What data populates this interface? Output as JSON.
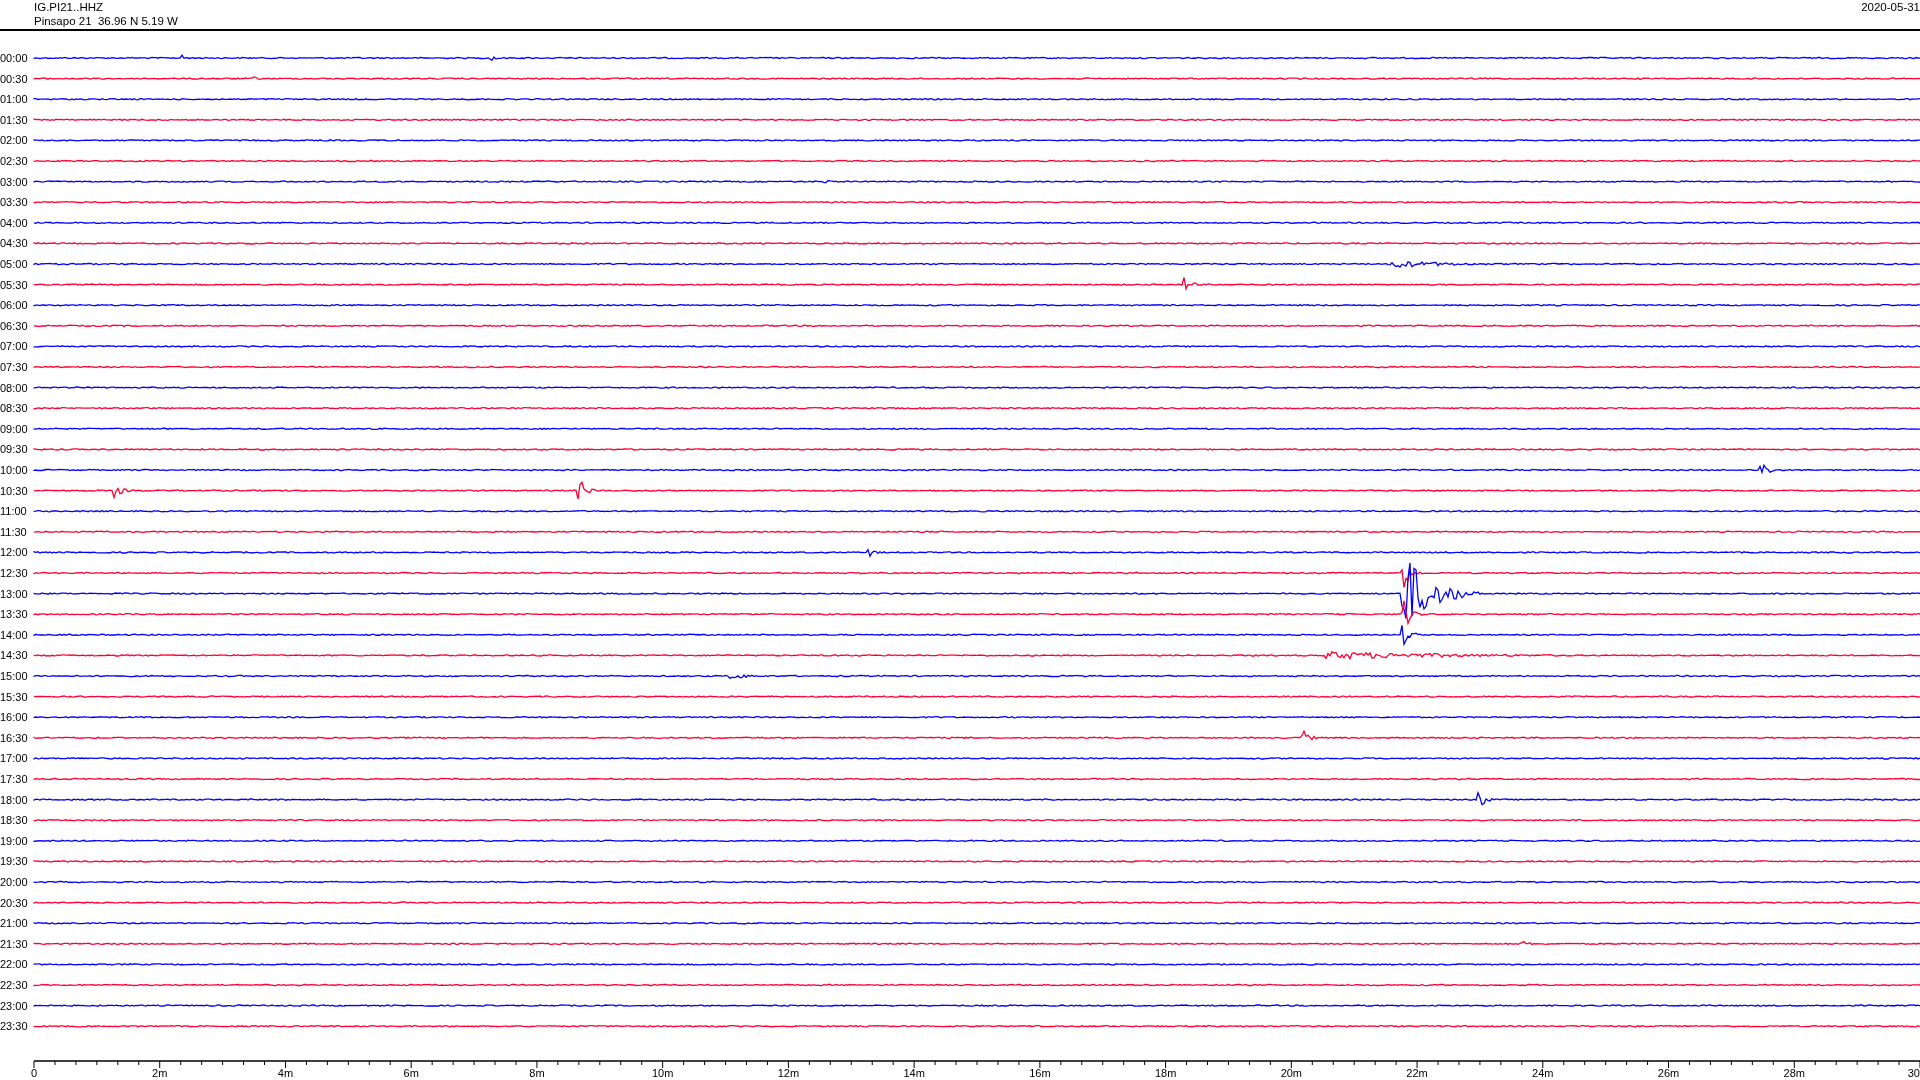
{
  "header": {
    "channel": "IG.PI21..HHZ",
    "station": "Pinsapo 21  36.96 N 5.19 W",
    "date": "2020-05-31"
  },
  "traces": [
    {
      "label": "00:00",
      "color": "#0000ff"
    },
    {
      "label": "00:30",
      "color": "#ff0033"
    },
    {
      "label": "01:00",
      "color": "#0000ff"
    },
    {
      "label": "01:30",
      "color": "#ff0033"
    },
    {
      "label": "02:00",
      "color": "#0000ff"
    },
    {
      "label": "02:30",
      "color": "#ff0033"
    },
    {
      "label": "03:00",
      "color": "#0000ff"
    },
    {
      "label": "03:30",
      "color": "#ff0033"
    },
    {
      "label": "04:00",
      "color": "#0000ff"
    },
    {
      "label": "04:30",
      "color": "#ff0033"
    },
    {
      "label": "05:00",
      "color": "#0000ff"
    },
    {
      "label": "05:30",
      "color": "#ff0033"
    },
    {
      "label": "06:00",
      "color": "#0000ff"
    },
    {
      "label": "06:30",
      "color": "#ff0033"
    },
    {
      "label": "07:00",
      "color": "#0000ff"
    },
    {
      "label": "07:30",
      "color": "#ff0033"
    },
    {
      "label": "08:00",
      "color": "#0000ff"
    },
    {
      "label": "08:30",
      "color": "#ff0033"
    },
    {
      "label": "09:00",
      "color": "#0000ff"
    },
    {
      "label": "09:30",
      "color": "#ff0033"
    },
    {
      "label": "10:00",
      "color": "#0000ff"
    },
    {
      "label": "10:30",
      "color": "#ff0033"
    },
    {
      "label": "11:00",
      "color": "#0000ff"
    },
    {
      "label": "11:30",
      "color": "#ff0033"
    },
    {
      "label": "12:00",
      "color": "#0000ff"
    },
    {
      "label": "12:30",
      "color": "#ff0033"
    },
    {
      "label": "13:00",
      "color": "#0000ff"
    },
    {
      "label": "13:30",
      "color": "#ff0033"
    },
    {
      "label": "14:00",
      "color": "#0000ff"
    },
    {
      "label": "14:30",
      "color": "#ff0033"
    },
    {
      "label": "15:00",
      "color": "#0000ff"
    },
    {
      "label": "15:30",
      "color": "#ff0033"
    },
    {
      "label": "16:00",
      "color": "#0000ff"
    },
    {
      "label": "16:30",
      "color": "#ff0033"
    },
    {
      "label": "17:00",
      "color": "#0000ff"
    },
    {
      "label": "17:30",
      "color": "#ff0033"
    },
    {
      "label": "18:00",
      "color": "#0000ff"
    },
    {
      "label": "18:30",
      "color": "#ff0033"
    },
    {
      "label": "19:00",
      "color": "#0000ff"
    },
    {
      "label": "19:30",
      "color": "#ff0033"
    },
    {
      "label": "20:00",
      "color": "#0000ff"
    },
    {
      "label": "20:30",
      "color": "#ff0033"
    },
    {
      "label": "21:00",
      "color": "#0000ff"
    },
    {
      "label": "21:30",
      "color": "#ff0033"
    },
    {
      "label": "22:00",
      "color": "#0000ff"
    },
    {
      "label": "22:30",
      "color": "#ff0033"
    },
    {
      "label": "23:00",
      "color": "#0000ff"
    },
    {
      "label": "23:30",
      "color": "#ff0033"
    }
  ],
  "axis": {
    "ticks": [
      "0",
      "2m",
      "4m",
      "6m",
      "8m",
      "10m",
      "12m",
      "14m",
      "16m",
      "18m",
      "20m",
      "22m",
      "24m",
      "26m",
      "28m",
      "30"
    ]
  }
}
